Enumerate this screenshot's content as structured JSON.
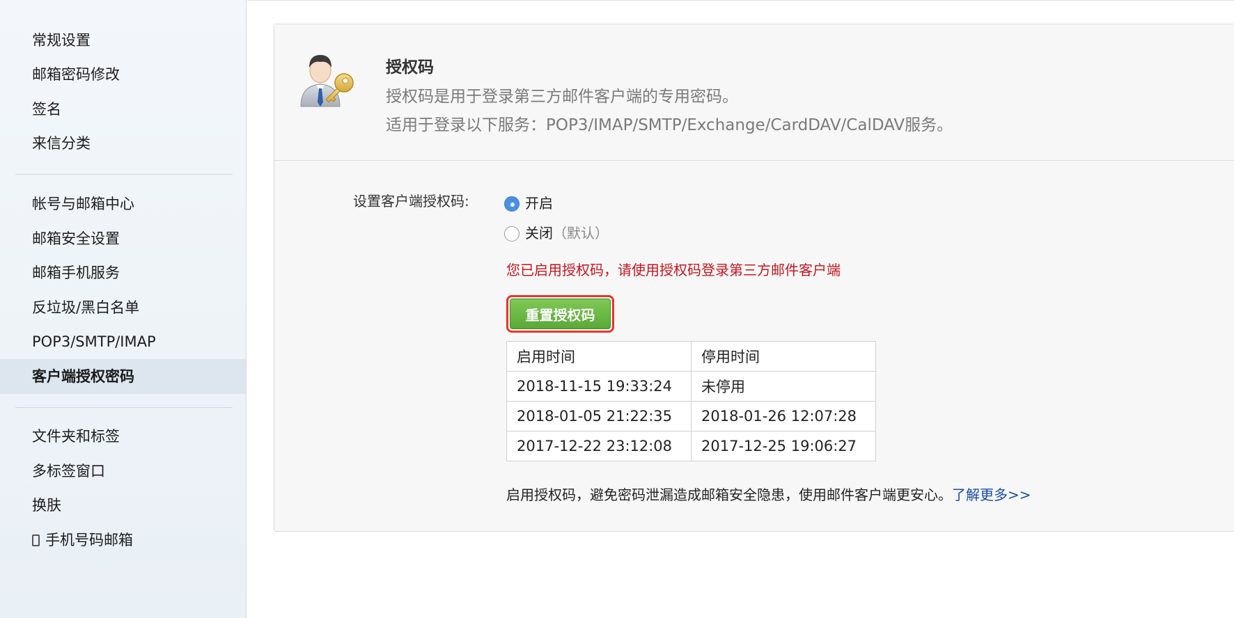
{
  "sidebar": {
    "group1": [
      "常规设置",
      "邮箱密码修改",
      "签名",
      "来信分类"
    ],
    "group2": [
      "帐号与邮箱中心",
      "邮箱安全设置",
      "邮箱手机服务",
      "反垃圾/黑白名单",
      "POP3/SMTP/IMAP",
      "客户端授权密码"
    ],
    "group3": [
      "文件夹和标签",
      "多标签窗口",
      "换肤",
      "手机号码邮箱"
    ],
    "active": "客户端授权密码"
  },
  "header": {
    "icon": "user-key-icon",
    "title": "授权码",
    "desc1": "授权码是用于登录第三方邮件客户端的专用密码。",
    "desc2": "适用于登录以下服务：POP3/IMAP/SMTP/Exchange/CardDAV/CalDAV服务。"
  },
  "setting": {
    "label": "设置客户端授权码:",
    "option_on": "开启",
    "option_off": "关闭",
    "option_off_note": "（默认）",
    "selected": "开启",
    "notice": "您已启用授权码，请使用授权码登录第三方邮件客户端",
    "reset_button": "重置授权码"
  },
  "history": {
    "headers": [
      "启用时间",
      "停用时间"
    ],
    "rows": [
      [
        "2018-11-15 19:33:24",
        "未停用"
      ],
      [
        "2018-01-05 21:22:35",
        "2018-01-26 12:07:28"
      ],
      [
        "2017-12-22 23:12:08",
        "2017-12-25 19:06:27"
      ]
    ]
  },
  "footer": {
    "note": "启用授权码，避免密码泄漏造成邮箱安全隐患，使用邮件客户端更安心。",
    "link": "了解更多>>"
  },
  "colors": {
    "notice": "#c0171f",
    "button_green": "#5aa936",
    "highlight_border": "#e5352b",
    "link": "#1a4fa0",
    "radio_selected": "#4a90e2"
  }
}
